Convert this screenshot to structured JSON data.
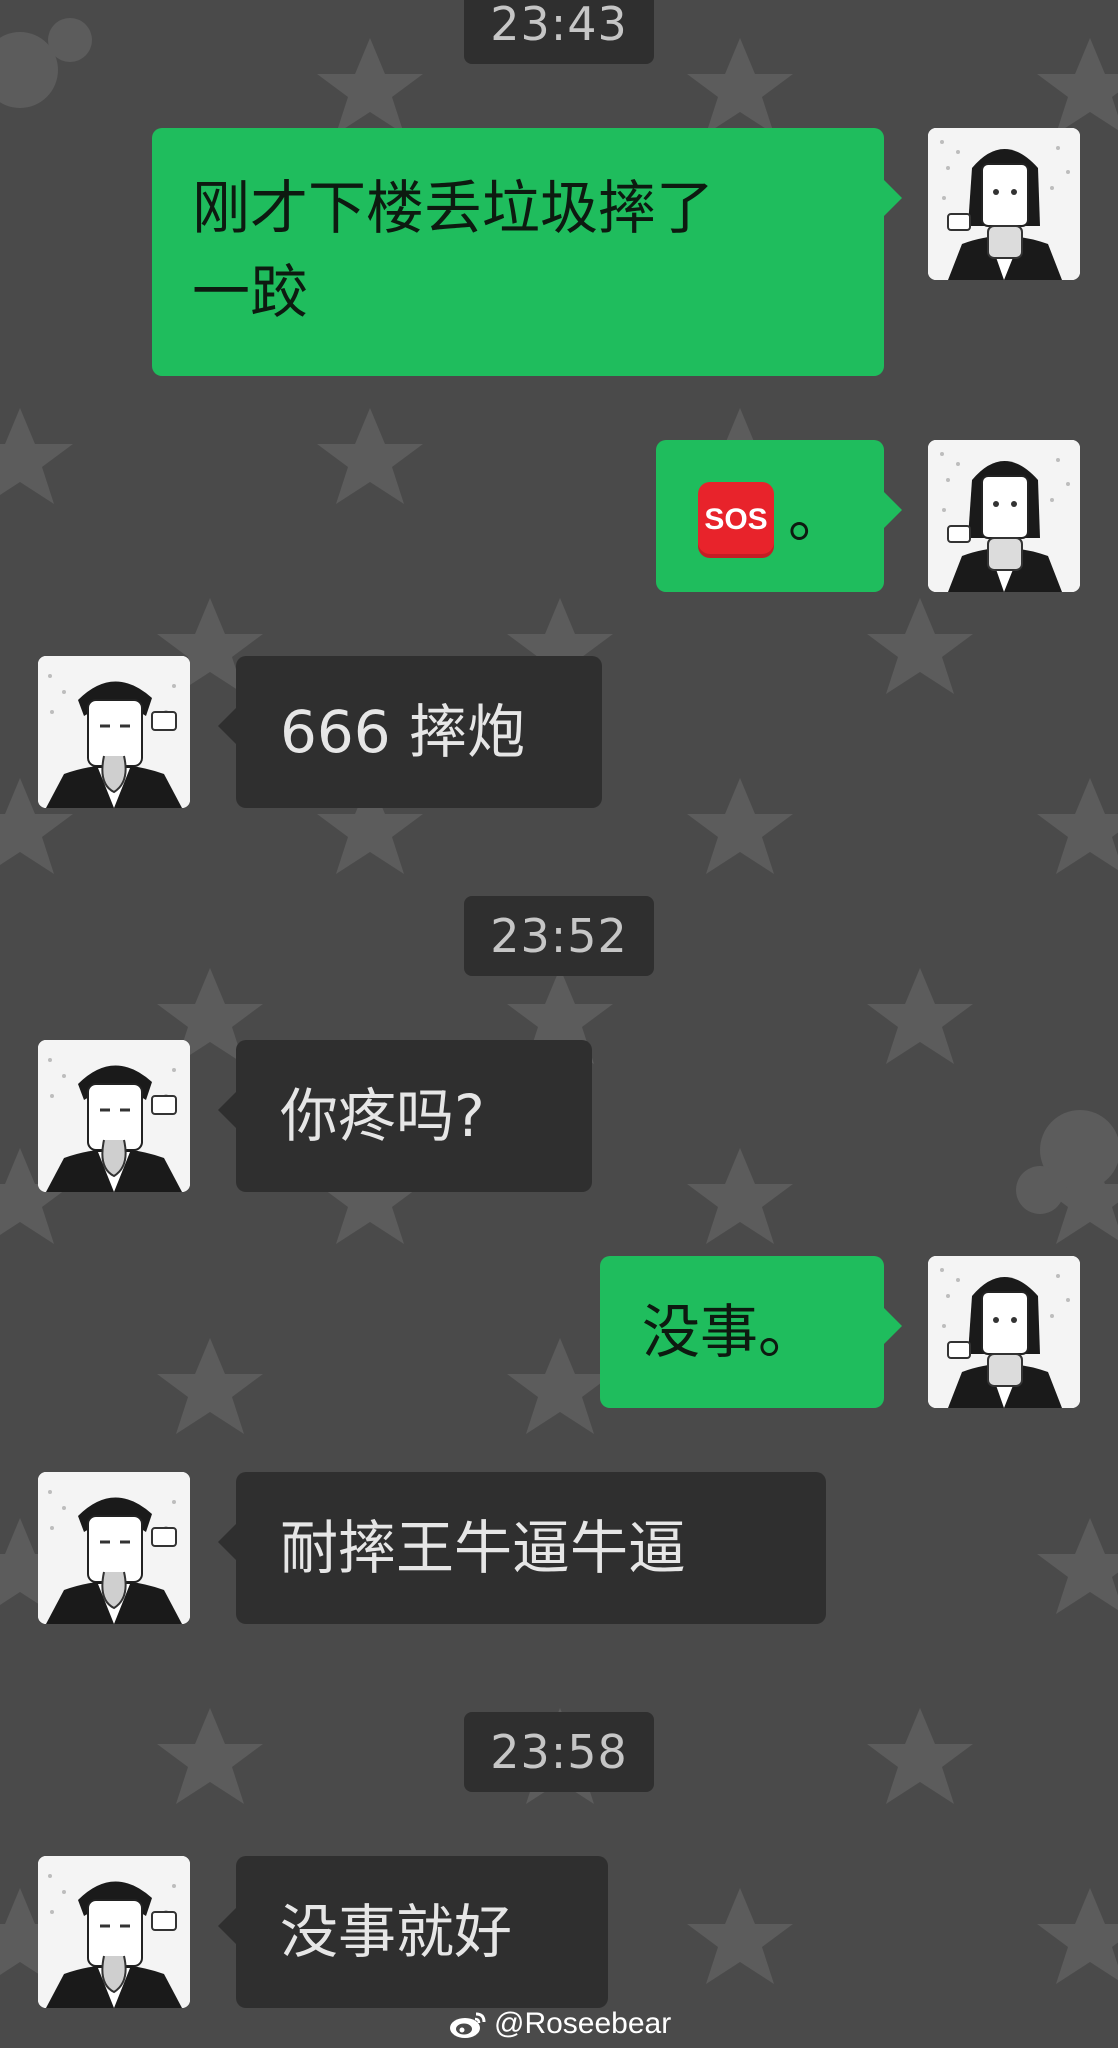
{
  "timestamps": [
    "23:43",
    "23:52",
    "23:58"
  ],
  "messages": [
    {
      "side": "out",
      "text_line1": "刚才下楼丢垃圾摔了",
      "text_line2": "一跤"
    },
    {
      "side": "out",
      "emoji_label": "SOS",
      "text": "。"
    },
    {
      "side": "in",
      "text": "666 摔炮"
    },
    {
      "side": "in",
      "text": "你疼吗?"
    },
    {
      "side": "out",
      "text": "没事。"
    },
    {
      "side": "in",
      "text": "耐摔王牛逼牛逼"
    },
    {
      "side": "in",
      "text": "没事就好"
    }
  ],
  "icons": {
    "sos": "sos-emoji-icon",
    "weibo": "weibo-logo-icon"
  },
  "watermark": {
    "text": "@Roseebear"
  },
  "colors": {
    "background": "#4a4a4a",
    "outgoing_bubble": "#1fbd5d",
    "incoming_bubble": "#2f2f2f",
    "timestamp_bg": "#2f2f2f",
    "star": "#5c5c5c"
  }
}
